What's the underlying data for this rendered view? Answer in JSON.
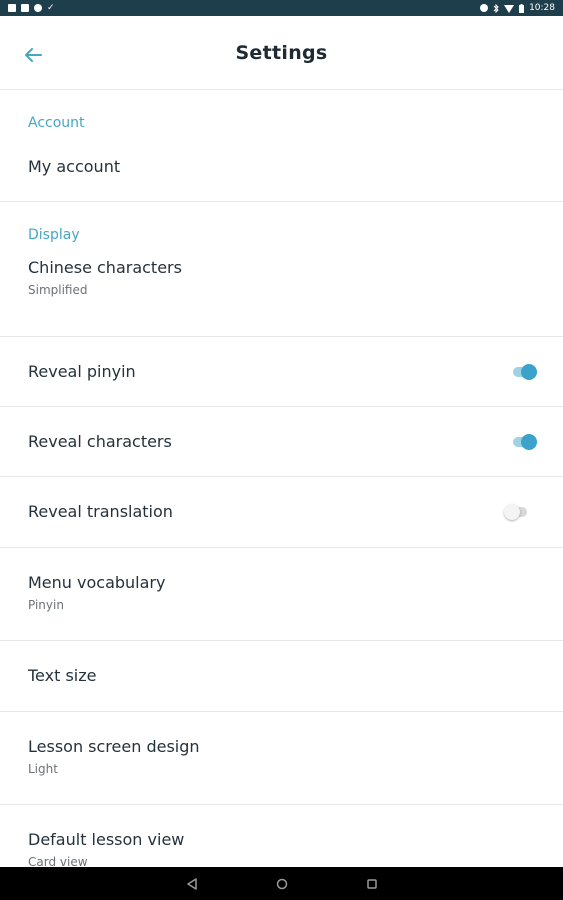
{
  "status_bar": {
    "time": "10:28",
    "left_icons": [
      "gallery-icon",
      "photos-icon",
      "sync-icon",
      "check-icon"
    ],
    "right_icons": [
      "alarm-icon",
      "bluetooth-icon",
      "wifi-icon",
      "battery-icon"
    ]
  },
  "header": {
    "title": "Settings",
    "back_icon": "arrow-left-icon"
  },
  "sections": {
    "account": {
      "header": "Account",
      "my_account": "My account"
    },
    "display": {
      "header": "Display",
      "chinese_characters": {
        "title": "Chinese characters",
        "value": "Simplified"
      },
      "reveal_pinyin": {
        "title": "Reveal pinyin",
        "enabled": true
      },
      "reveal_characters": {
        "title": "Reveal characters",
        "enabled": true
      },
      "reveal_translation": {
        "title": "Reveal translation",
        "enabled": false
      },
      "menu_vocabulary": {
        "title": "Menu vocabulary",
        "value": "Pinyin"
      },
      "text_size": {
        "title": "Text size"
      },
      "lesson_screen_design": {
        "title": "Lesson screen design",
        "value": "Light"
      },
      "default_lesson_view": {
        "title": "Default lesson view",
        "value": "Card view"
      }
    }
  },
  "colors": {
    "accent": "#46a7c2",
    "toggle_on": "#3aa2cb",
    "status_bar": "#1e3e4c"
  },
  "nav_bar": {
    "icons": [
      "back-triangle-icon",
      "home-circle-icon",
      "recents-square-icon"
    ]
  }
}
